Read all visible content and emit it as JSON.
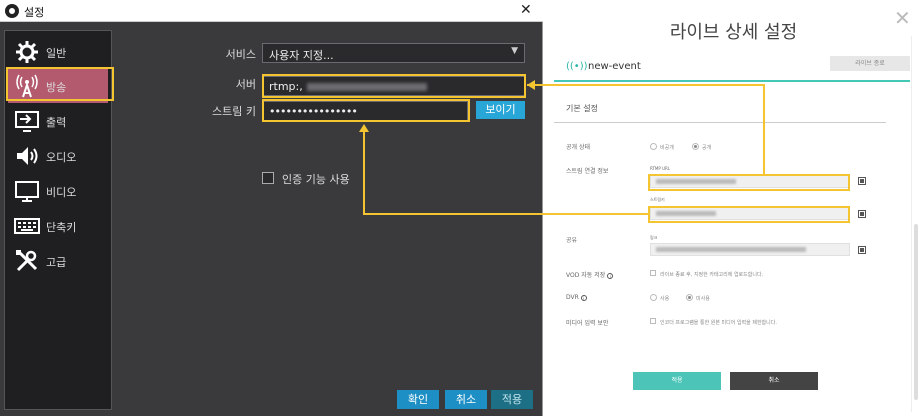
{
  "obs": {
    "title": "설정",
    "close": "✕",
    "sidebar": [
      {
        "label": "일반",
        "icon": "gear-icon"
      },
      {
        "label": "방송",
        "icon": "broadcast-antenna-icon",
        "active": true
      },
      {
        "label": "출력",
        "icon": "output-icon"
      },
      {
        "label": "오디오",
        "icon": "speaker-icon"
      },
      {
        "label": "비디오",
        "icon": "monitor-icon"
      },
      {
        "label": "단축키",
        "icon": "keyboard-icon"
      },
      {
        "label": "고급",
        "icon": "tools-icon"
      }
    ],
    "service_label": "서비스",
    "service_value": "사용자 지정...",
    "server_label": "서버",
    "server_value": "rtmp:,",
    "stream_key_label": "스트림 키",
    "stream_key_value": "••••••••••••••••",
    "show_button": "보이기",
    "auth_checkbox_label": "인증 기능 사용",
    "buttons": {
      "ok": "확인",
      "cancel": "취소",
      "apply": "적용"
    }
  },
  "live": {
    "title": "라이브 상세 설정",
    "event_name": "new-event",
    "end_button": "라이브 종료",
    "section_basic": "기본 설정",
    "visibility_label": "공개 상태",
    "visibility_private": "비공개",
    "visibility_public": "공개",
    "stream_info_label": "스트림 연결 정보",
    "rtmp_url_label": "RTMP URL",
    "stream_key_label": "스트림키",
    "share_label": "공유",
    "share_sub_label": "링크",
    "vod_label": "VOD 자동 저장",
    "vod_text": "라이브 종료 후, 지정한 카테고리에 업로드합니다.",
    "dvr_label": "DVR",
    "dvr_use": "사용",
    "dvr_nouse": "미사용",
    "media_label": "미디어 입력 보안",
    "media_text": "인코더 프로그램을 통한 원본 미디어 입력을 제한합니다.",
    "save_button": "적용",
    "cancel_button": "취소"
  },
  "colors": {
    "highlight": "#f4c531",
    "obs_active": "#b35a6e",
    "teal": "#4cc5b8",
    "obs_button": "#1e8fc4"
  }
}
